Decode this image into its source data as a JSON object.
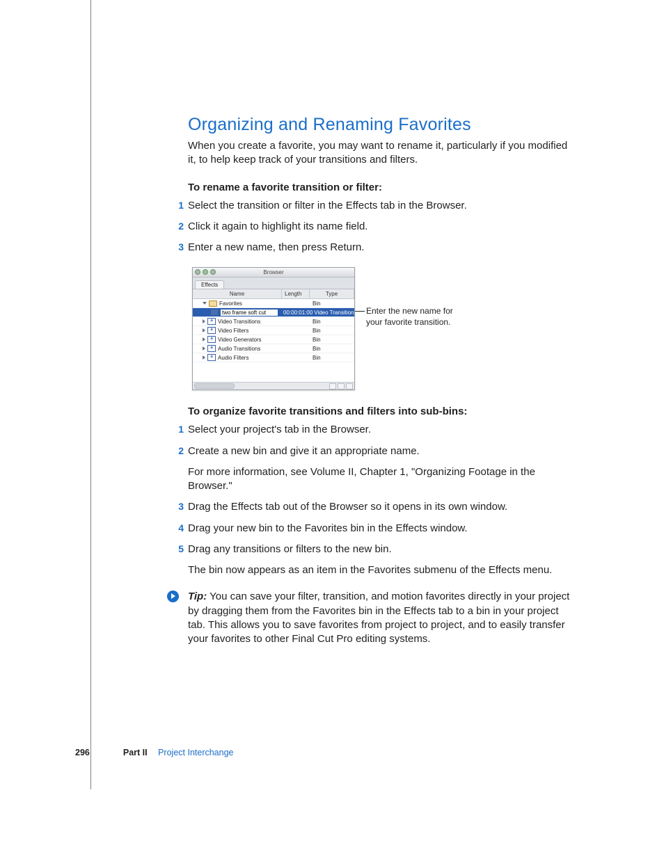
{
  "heading": "Organizing and Renaming Favorites",
  "intro": "When you create a favorite, you may want to rename it, particularly if you modified it, to help keep track of your transitions and filters.",
  "section1": {
    "title": "To rename a favorite transition or filter:",
    "steps": [
      "Select the transition or filter in the Effects tab in the Browser.",
      "Click it again to highlight its name field.",
      "Enter a new name, then press Return."
    ]
  },
  "figure": {
    "window_title": "Browser",
    "tab": "Effects",
    "columns": {
      "name": "Name",
      "length": "Length",
      "type": "Type"
    },
    "rows": [
      {
        "kind": "bin-open",
        "indent": 1,
        "name": "Favorites",
        "length": "",
        "type": "Bin"
      },
      {
        "kind": "edit",
        "indent": 2,
        "name": "two frame soft cut",
        "length": "00:00:01:00",
        "type": "Video Transition"
      },
      {
        "kind": "a",
        "indent": 1,
        "name": "Video Transitions",
        "length": "",
        "type": "Bin"
      },
      {
        "kind": "a",
        "indent": 1,
        "name": "Video Filters",
        "length": "",
        "type": "Bin"
      },
      {
        "kind": "a",
        "indent": 1,
        "name": "Video Generators",
        "length": "",
        "type": "Bin"
      },
      {
        "kind": "a",
        "indent": 1,
        "name": "Audio Transitions",
        "length": "",
        "type": "Bin"
      },
      {
        "kind": "a",
        "indent": 1,
        "name": "Audio Filters",
        "length": "",
        "type": "Bin"
      }
    ],
    "callout": "Enter the new name for your favorite transition."
  },
  "section2": {
    "title": "To organize favorite transitions and filters into sub-bins:",
    "steps": [
      {
        "text": "Select your project's tab in the Browser."
      },
      {
        "text": "Create a new bin and give it an appropriate name.",
        "follow": "For more information, see Volume II, Chapter 1, \"Organizing Footage in the Browser.\""
      },
      {
        "text": "Drag the Effects tab out of the Browser so it opens in its own window."
      },
      {
        "text": "Drag your new bin to the Favorites bin in the Effects window."
      },
      {
        "text": "Drag any transitions or filters to the new bin.",
        "follow": "The bin now appears as an item in the Favorites submenu of the Effects menu."
      }
    ]
  },
  "tip": {
    "label": "Tip:",
    "text": "  You can save your filter, transition, and motion favorites directly in your project by dragging them from the Favorites bin in the Effects tab to a bin in your project tab. This allows you to save favorites from project to project, and to easily transfer your favorites to other Final Cut Pro editing systems."
  },
  "footer": {
    "page": "296",
    "part_label": "Part II",
    "part_title": "Project Interchange"
  }
}
